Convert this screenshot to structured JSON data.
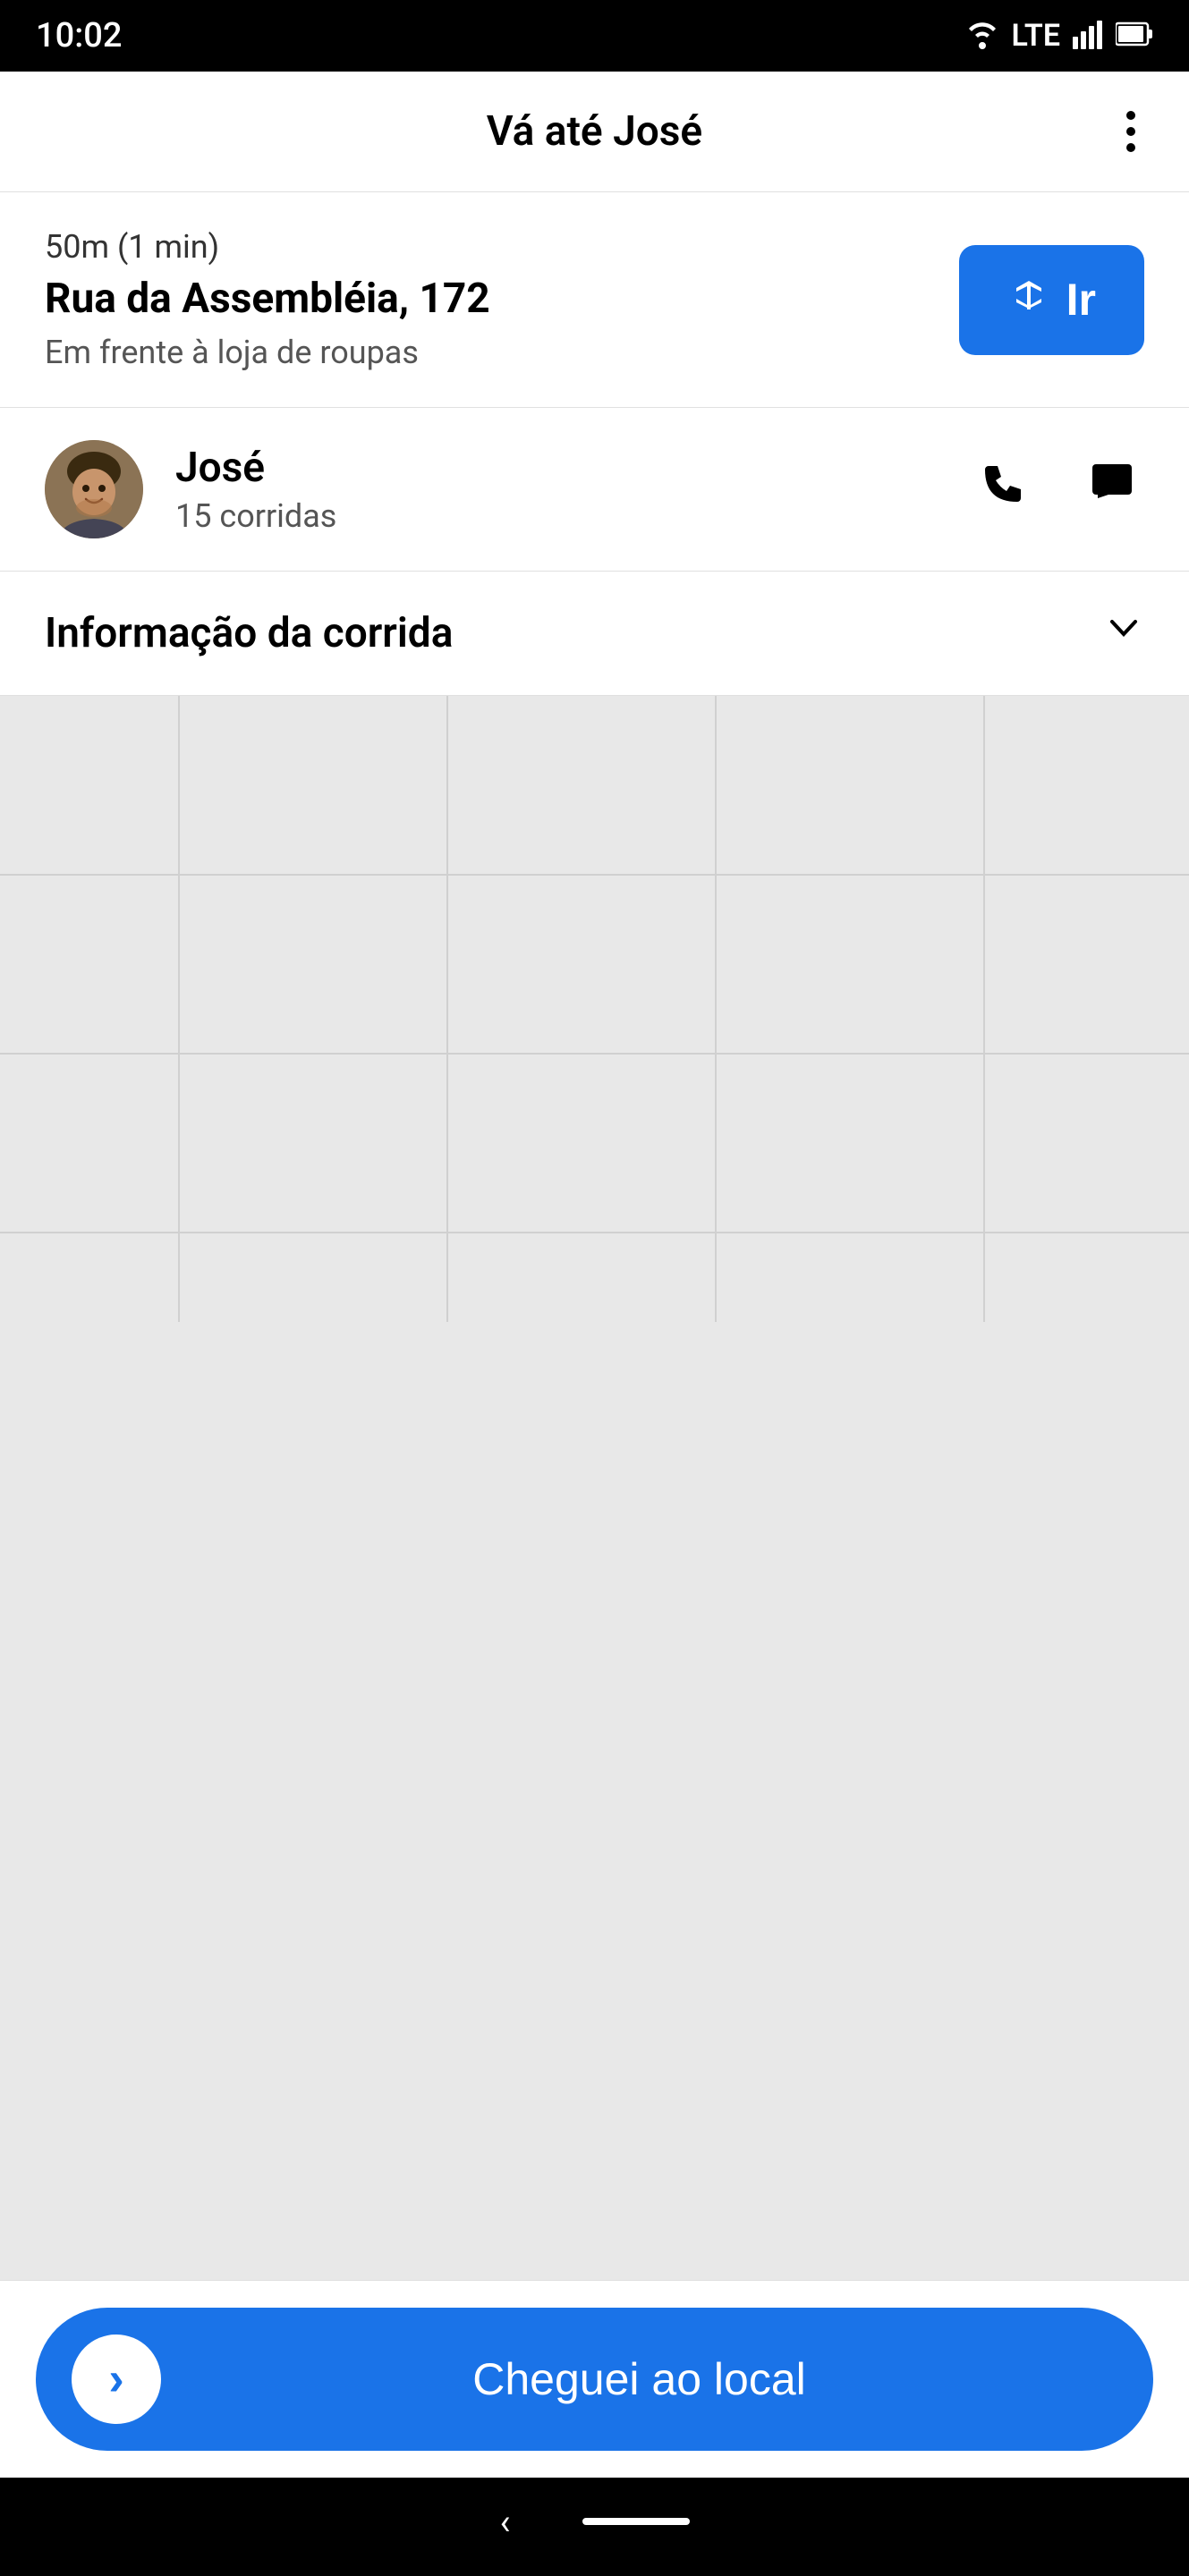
{
  "statusBar": {
    "time": "10:02",
    "wifi": "▼",
    "lte": "LTE",
    "signal": "▲",
    "battery": "🔋"
  },
  "header": {
    "title": "Vá até José",
    "menuLabel": "more options"
  },
  "pickup": {
    "distance": "50m (1 min)",
    "address": "Rua da Assembléia, 172",
    "landmark": "Em frente à loja de roupas",
    "goButtonLabel": "Ir"
  },
  "passenger": {
    "name": "José",
    "rides": "15 corridas",
    "phoneLabel": "phone",
    "messageLabel": "message"
  },
  "rideInfo": {
    "label": "Informação da corrida",
    "chevron": "∨"
  },
  "bottomButton": {
    "label": "Cheguei ao local",
    "arrowIcon": "›"
  },
  "nav": {
    "backIcon": "‹",
    "homeBar": ""
  }
}
